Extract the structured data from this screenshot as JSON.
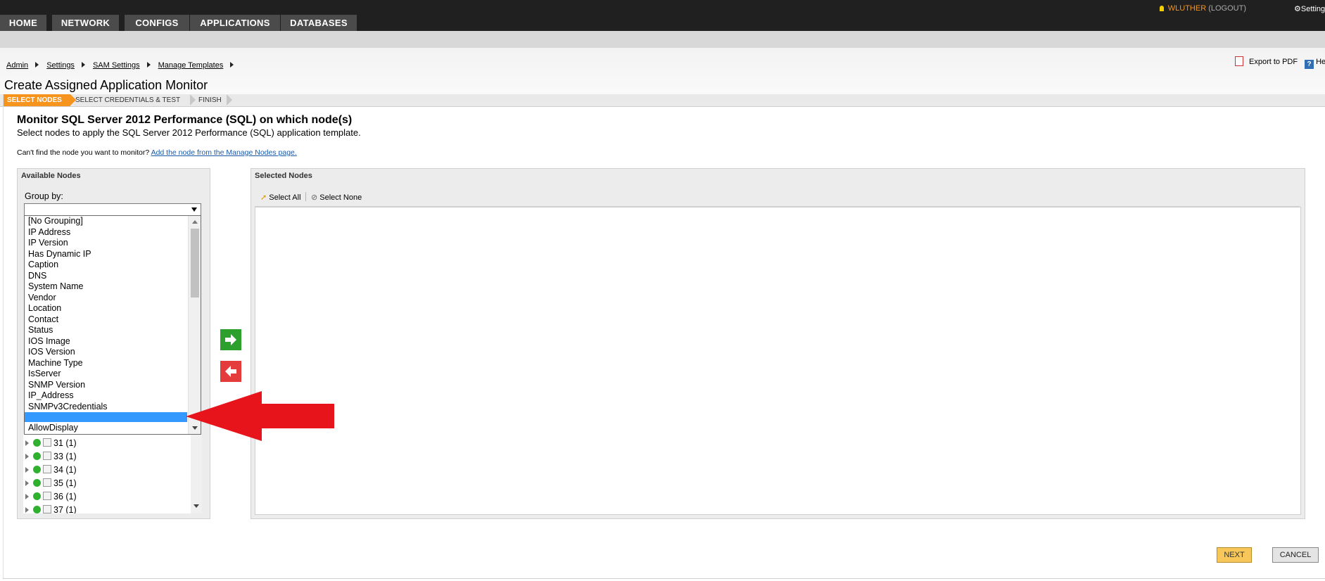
{
  "nav": {
    "tabs": [
      {
        "label": "HOME"
      },
      {
        "label": "NETWORK"
      },
      {
        "label": "CONFIGS"
      },
      {
        "label": "APPLICATIONS"
      },
      {
        "label": "DATABASES"
      }
    ],
    "user": "WLUTHER",
    "logout": "(LOGOUT)",
    "settings": "Settings"
  },
  "breadcrumb": [
    "Admin",
    "Settings",
    "SAM Settings",
    "Manage Templates"
  ],
  "page": {
    "title": "Create Assigned Application Monitor",
    "export_pdf": "Export to PDF",
    "help": "He"
  },
  "wizard": {
    "steps": [
      "SELECT NODES",
      "SELECT CREDENTIALS & TEST",
      "FINISH"
    ],
    "active_step": "SELECT NODES"
  },
  "content": {
    "heading": "Monitor SQL Server 2012 Performance (SQL) on which node(s)",
    "description": "Select nodes to apply the SQL Server 2012 Performance (SQL) application template.",
    "cant_find": "Can't find the node you want to monitor?",
    "add_node_link": "Add the node from the Manage Nodes page."
  },
  "available": {
    "title": "Available Nodes",
    "group_by_label": "Group by:",
    "group_by_value": "",
    "options": [
      "[No Grouping]",
      "IP Address",
      "IP Version",
      "Has Dynamic IP",
      "Caption",
      "DNS",
      "System Name",
      "Vendor",
      "Location",
      "Contact",
      "Status",
      "IOS Image",
      "IOS Version",
      "Machine Type",
      "IsServer",
      "SNMP Version",
      "IP_Address",
      "SNMPv3Credentials",
      "",
      "AllowDisplay"
    ],
    "highlighted_option_index": 18,
    "tree_rows": [
      "31 (1)",
      "33 (1)",
      "34 (1)",
      "35 (1)",
      "36 (1)",
      "37 (1)"
    ]
  },
  "selected": {
    "title": "Selected Nodes",
    "select_all": "Select All",
    "select_none": "Select None"
  },
  "buttons": {
    "next": "NEXT",
    "cancel": "CANCEL"
  },
  "colors": {
    "accent_orange": "#f7941d",
    "add_green": "#2ca02c",
    "remove_red": "#e43c3c",
    "highlight_blue": "#3399ff",
    "annotation_red": "#e8141c"
  }
}
